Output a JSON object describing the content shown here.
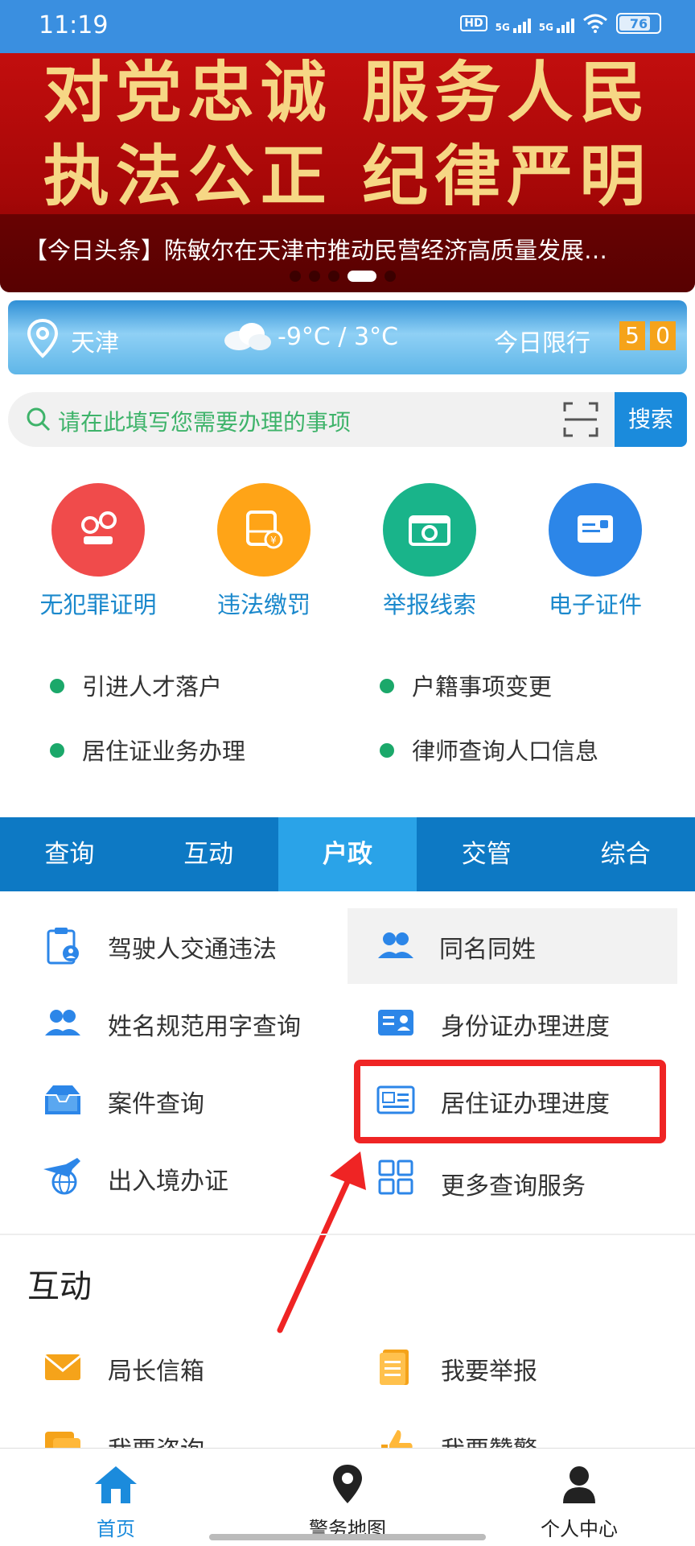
{
  "status_bar": {
    "time": "11:19",
    "battery": "76",
    "network": [
      "HD",
      "5G",
      "5G"
    ]
  },
  "banner": {
    "line1": "对党忠诚  服务人民",
    "line2": "执法公正  纪律严明",
    "headline": "【今日头条】陈敏尔在天津市推动民营经济高质量发展…"
  },
  "weather": {
    "city": "天津",
    "temperature": "-9°C / 3°C",
    "limit_label": "今日限行",
    "limit_nums": [
      "5",
      "0"
    ]
  },
  "search": {
    "placeholder": "请在此填写您需要办理的事项",
    "button": "搜索"
  },
  "quick_services": [
    {
      "label": "无犯罪证明",
      "icon": "handcuffs-icon",
      "color": "#f04b4b"
    },
    {
      "label": "违法缴罚",
      "icon": "bus-fine-icon",
      "color": "#ffa417"
    },
    {
      "label": "举报线索",
      "icon": "camera-icon",
      "color": "#19b48a"
    },
    {
      "label": "电子证件",
      "icon": "id-card-icon",
      "color": "#2c86e8"
    }
  ],
  "quick_links": [
    "引进人才落户",
    "户籍事项变更",
    "居住证业务办理",
    "律师查询人口信息"
  ],
  "tabs": {
    "items": [
      "查询",
      "互动",
      "户政",
      "交管",
      "综合"
    ],
    "active": "户政"
  },
  "query_services": [
    {
      "label": "驾驶人交通违法",
      "icon": "clipboard-user-icon"
    },
    {
      "label": "同名同姓",
      "icon": "people-icon"
    },
    {
      "label": "姓名规范用字查询",
      "icon": "people-icon"
    },
    {
      "label": "身份证办理进度",
      "icon": "id-card-icon"
    },
    {
      "label": "案件查询",
      "icon": "inbox-icon"
    },
    {
      "label": "居住证办理进度",
      "icon": "residence-card-icon"
    },
    {
      "label": "出入境办证",
      "icon": "plane-globe-icon"
    },
    {
      "label": "更多查询服务",
      "icon": "grid-icon"
    }
  ],
  "interaction_section": {
    "title": "互动",
    "items": [
      {
        "label": "局长信箱",
        "icon": "mail-icon"
      },
      {
        "label": "我要举报",
        "icon": "document-icon"
      },
      {
        "label": "我要咨询",
        "icon": "chat-icon"
      },
      {
        "label": "我要赞警",
        "icon": "thumb-up-icon"
      }
    ]
  },
  "bottom_nav": [
    {
      "label": "首页",
      "icon": "home-icon",
      "active": true
    },
    {
      "label": "警务地图",
      "icon": "map-pin-icon",
      "active": false
    },
    {
      "label": "个人中心",
      "icon": "user-icon",
      "active": false
    }
  ],
  "colors": {
    "primary": "#0d79c4",
    "active_tab": "#2aa3e8",
    "highlight_box": "#ef2424",
    "accent_green": "#1ba86a"
  }
}
